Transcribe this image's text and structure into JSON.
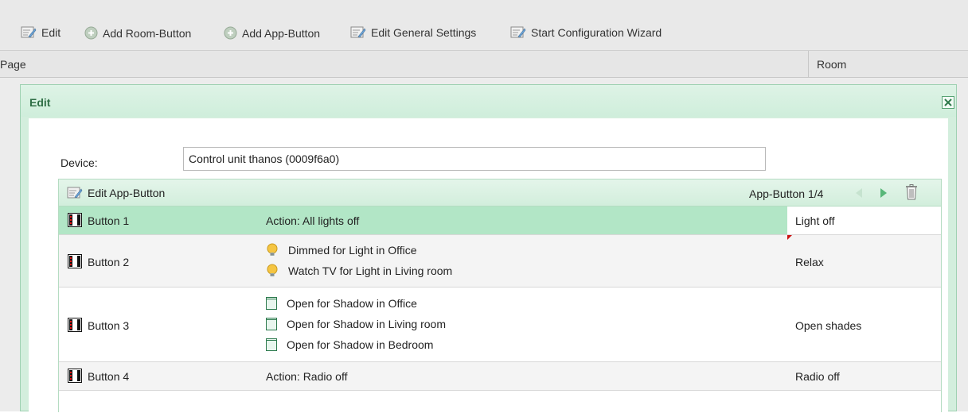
{
  "toolbar": {
    "edit": "Edit",
    "add_room": "Add Room-Button",
    "add_app": "Add App-Button",
    "edit_general": "Edit General Settings",
    "wizard": "Start Configuration Wizard"
  },
  "table_header": {
    "page": "Page",
    "room": "Room"
  },
  "dialog": {
    "title": "Edit",
    "device_label": "Device:",
    "device_value": "Control unit thanos (0009f6a0)",
    "panel": {
      "edit_label": "Edit App-Button",
      "pager": "App-Button 1/4"
    },
    "rows": [
      {
        "name": "Button 1",
        "action": "Action: All lights off",
        "scene": "Light off"
      },
      {
        "name": "Button 2",
        "actions": [
          "Dimmed for Light in Office",
          "Watch TV for Light in Living room"
        ],
        "scene": "Relax"
      },
      {
        "name": "Button 3",
        "actions": [
          "Open for Shadow in Office",
          "Open for Shadow in Living room",
          "Open for Shadow in Bedroom"
        ],
        "scene": "Open shades"
      },
      {
        "name": "Button 4",
        "action": "Action: Radio off",
        "scene": "Radio off"
      }
    ]
  },
  "colors": {
    "accent_green": "#b2e6c6",
    "dialog_border": "#9fd1b2",
    "title_text": "#2f6e46"
  },
  "icons": {
    "edit": "edit-icon",
    "add": "add-circle-icon",
    "button": "button-device-icon",
    "light": "light-bulb-icon",
    "shade": "shade-icon",
    "prev": "prev-arrow-icon",
    "next": "next-arrow-icon",
    "trash": "trash-icon",
    "close": "close-icon"
  }
}
